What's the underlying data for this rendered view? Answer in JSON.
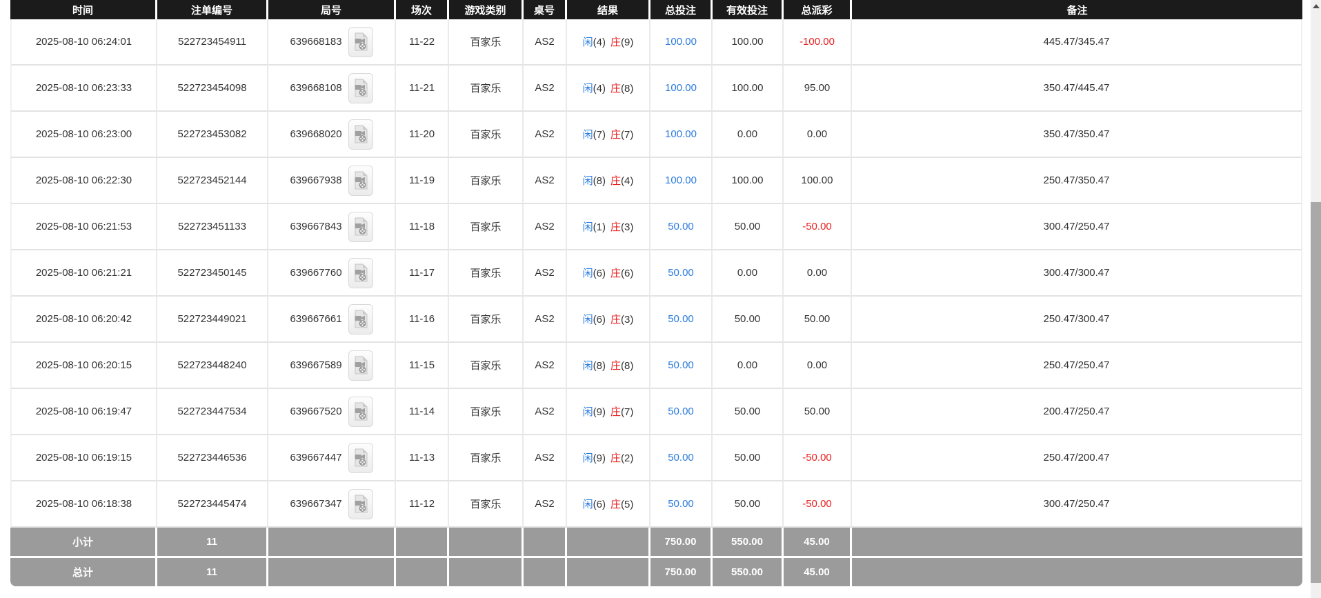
{
  "colors": {
    "accent_blue": "#2b7bdd",
    "accent_red": "#e82020",
    "header_bg": "#1b1b1b",
    "summary_bg": "#9b9b9b"
  },
  "icons": {
    "round_cell_icon": "video-file-icon",
    "scrollbar_icon": "triangle-up-icon"
  },
  "table": {
    "columns": [
      "时间",
      "注单编号",
      "局号",
      "场次",
      "游戏类别",
      "桌号",
      "结果",
      "总投注",
      "有效投注",
      "总派彩",
      "备注"
    ],
    "rows": [
      {
        "time": "2025-08-10 06:24:01",
        "bet_id": "522723454911",
        "round_id": "639668183",
        "session": "11-22",
        "game_type": "百家乐",
        "table_no": "AS2",
        "result_player": "闲",
        "result_player_score": "(4)",
        "result_banker": "庄",
        "result_banker_score": "(9)",
        "total_bet": "100.00",
        "valid_bet": "100.00",
        "payout": "-100.00",
        "note": "445.47/345.47"
      },
      {
        "time": "2025-08-10 06:23:33",
        "bet_id": "522723454098",
        "round_id": "639668108",
        "session": "11-21",
        "game_type": "百家乐",
        "table_no": "AS2",
        "result_player": "闲",
        "result_player_score": "(4)",
        "result_banker": "庄",
        "result_banker_score": "(8)",
        "total_bet": "100.00",
        "valid_bet": "100.00",
        "payout": "95.00",
        "note": "350.47/445.47"
      },
      {
        "time": "2025-08-10 06:23:00",
        "bet_id": "522723453082",
        "round_id": "639668020",
        "session": "11-20",
        "game_type": "百家乐",
        "table_no": "AS2",
        "result_player": "闲",
        "result_player_score": "(7)",
        "result_banker": "庄",
        "result_banker_score": "(7)",
        "total_bet": "100.00",
        "valid_bet": "0.00",
        "payout": "0.00",
        "note": "350.47/350.47"
      },
      {
        "time": "2025-08-10 06:22:30",
        "bet_id": "522723452144",
        "round_id": "639667938",
        "session": "11-19",
        "game_type": "百家乐",
        "table_no": "AS2",
        "result_player": "闲",
        "result_player_score": "(8)",
        "result_banker": "庄",
        "result_banker_score": "(4)",
        "total_bet": "100.00",
        "valid_bet": "100.00",
        "payout": "100.00",
        "note": "250.47/350.47"
      },
      {
        "time": "2025-08-10 06:21:53",
        "bet_id": "522723451133",
        "round_id": "639667843",
        "session": "11-18",
        "game_type": "百家乐",
        "table_no": "AS2",
        "result_player": "闲",
        "result_player_score": "(1)",
        "result_banker": "庄",
        "result_banker_score": "(3)",
        "total_bet": "50.00",
        "valid_bet": "50.00",
        "payout": "-50.00",
        "note": "300.47/250.47"
      },
      {
        "time": "2025-08-10 06:21:21",
        "bet_id": "522723450145",
        "round_id": "639667760",
        "session": "11-17",
        "game_type": "百家乐",
        "table_no": "AS2",
        "result_player": "闲",
        "result_player_score": "(6)",
        "result_banker": "庄",
        "result_banker_score": "(6)",
        "total_bet": "50.00",
        "valid_bet": "0.00",
        "payout": "0.00",
        "note": "300.47/300.47"
      },
      {
        "time": "2025-08-10 06:20:42",
        "bet_id": "522723449021",
        "round_id": "639667661",
        "session": "11-16",
        "game_type": "百家乐",
        "table_no": "AS2",
        "result_player": "闲",
        "result_player_score": "(6)",
        "result_banker": "庄",
        "result_banker_score": "(3)",
        "total_bet": "50.00",
        "valid_bet": "50.00",
        "payout": "50.00",
        "note": "250.47/300.47"
      },
      {
        "time": "2025-08-10 06:20:15",
        "bet_id": "522723448240",
        "round_id": "639667589",
        "session": "11-15",
        "game_type": "百家乐",
        "table_no": "AS2",
        "result_player": "闲",
        "result_player_score": "(8)",
        "result_banker": "庄",
        "result_banker_score": "(8)",
        "total_bet": "50.00",
        "valid_bet": "0.00",
        "payout": "0.00",
        "note": "250.47/250.47"
      },
      {
        "time": "2025-08-10 06:19:47",
        "bet_id": "522723447534",
        "round_id": "639667520",
        "session": "11-14",
        "game_type": "百家乐",
        "table_no": "AS2",
        "result_player": "闲",
        "result_player_score": "(9)",
        "result_banker": "庄",
        "result_banker_score": "(7)",
        "total_bet": "50.00",
        "valid_bet": "50.00",
        "payout": "50.00",
        "note": "200.47/250.47"
      },
      {
        "time": "2025-08-10 06:19:15",
        "bet_id": "522723446536",
        "round_id": "639667447",
        "session": "11-13",
        "game_type": "百家乐",
        "table_no": "AS2",
        "result_player": "闲",
        "result_player_score": "(9)",
        "result_banker": "庄",
        "result_banker_score": "(2)",
        "total_bet": "50.00",
        "valid_bet": "50.00",
        "payout": "-50.00",
        "note": "250.47/200.47"
      },
      {
        "time": "2025-08-10 06:18:38",
        "bet_id": "522723445474",
        "round_id": "639667347",
        "session": "11-12",
        "game_type": "百家乐",
        "table_no": "AS2",
        "result_player": "闲",
        "result_player_score": "(6)",
        "result_banker": "庄",
        "result_banker_score": "(5)",
        "total_bet": "50.00",
        "valid_bet": "50.00",
        "payout": "-50.00",
        "note": "300.47/250.47"
      }
    ],
    "subtotal": {
      "label": "小计",
      "count": "11",
      "total_bet": "750.00",
      "valid_bet": "550.00",
      "payout": "45.00"
    },
    "total": {
      "label": "总计",
      "count": "11",
      "total_bet": "750.00",
      "valid_bet": "550.00",
      "payout": "45.00"
    }
  }
}
